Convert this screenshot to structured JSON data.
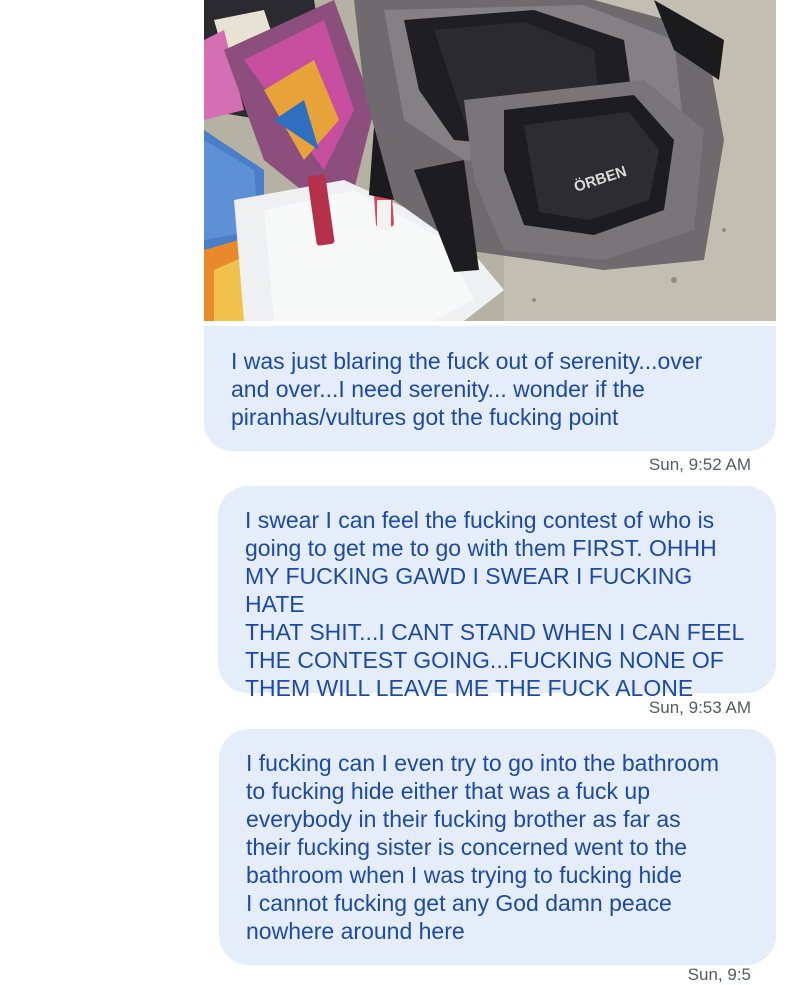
{
  "conversation": {
    "photo": {
      "icon": "photo-attachment",
      "brand_text": "ÖRBEN"
    },
    "messages": [
      {
        "text": "I was just blaring the fuck out of serenity...over\nand over...I need serenity... wonder if the\npiranhas/vultures got the fucking point",
        "time": "Sun, 9:52 AM"
      },
      {
        "text": "I swear I can feel the fucking contest of who is\ngoing to get me to go with them FIRST. OHHH\nMY FUCKING GAWD I SWEAR I FUCKING HATE\nTHAT SHIT...I CANT STAND WHEN I CAN FEEL\nTHE CONTEST GOING...FUCKING NONE OF\nTHEM WILL LEAVE ME THE FUCK ALONE",
        "time": "Sun, 9:53 AM"
      },
      {
        "text": "I fucking can I even try to go into the bathroom\nto fucking hide either that was a fuck up\neverybody in their fucking brother as far as\ntheir fucking sister is concerned went to the\nbathroom when I was trying to fucking hide\nI cannot fucking get any God damn peace\nnowhere around here",
        "time": "Sun, 9:5"
      }
    ]
  }
}
